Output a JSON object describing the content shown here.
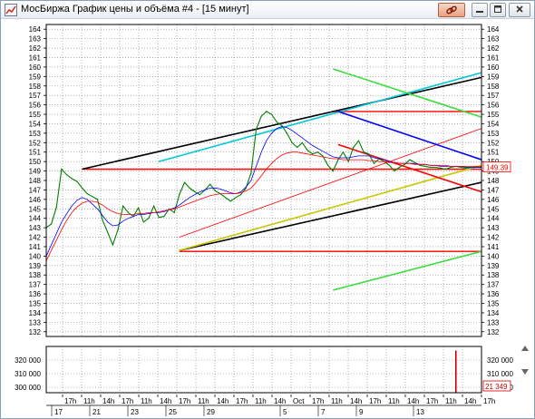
{
  "window": {
    "title": "МосБиржа График цены и объёма #4 - [15 минут]",
    "icon": "chart-app-icon",
    "controls": {
      "link": "link-icon",
      "minimize": "minimize-icon",
      "maximize": "maximize-icon",
      "close": "close-icon"
    }
  },
  "colors": {
    "price": "#008000",
    "ma_blue": "#0000ff",
    "ma_red": "#ff0000",
    "channel_black": "#000000",
    "channel_cyan": "#00c8d8",
    "channel_green": "#3cdc3c",
    "trend_yellow": "#c8c800",
    "volume_bar": "#cc0000",
    "grid": "#808080"
  },
  "chart_data": [
    {
      "type": "line",
      "name": "price",
      "y_ticks": [
        132,
        133,
        134,
        135,
        136,
        137,
        138,
        139,
        140,
        141,
        142,
        143,
        144,
        145,
        146,
        147,
        148,
        149,
        150,
        151,
        152,
        153,
        154,
        155,
        156,
        157,
        158,
        159,
        160,
        161,
        162,
        163,
        164
      ],
      "ylim": [
        131.5,
        164.5
      ],
      "current_price_label": "149.39",
      "x_time_labels": [
        "17h",
        "11h",
        "14h",
        "17h",
        "11h",
        "14h",
        "17h",
        "11h",
        "14h",
        "17h",
        "11h",
        "14h",
        "Oct",
        "17h",
        "11h",
        "14h",
        "17h",
        "11h",
        "14h",
        "17h",
        "11h",
        "14h",
        "17h"
      ],
      "x_date_labels": [
        "17",
        "21",
        "23",
        "25",
        "29",
        "5",
        "7",
        "9",
        "13"
      ],
      "x": [
        0,
        2,
        4,
        6,
        8,
        10,
        12,
        14,
        16,
        18,
        20,
        22,
        24,
        26,
        28,
        30,
        32,
        34,
        36,
        38,
        40,
        42,
        44,
        46,
        48,
        50,
        52,
        54,
        56,
        58,
        60,
        62,
        64,
        66,
        68,
        70,
        72,
        74,
        76,
        78,
        80,
        82,
        84,
        86,
        88,
        90,
        92,
        94,
        96,
        98,
        100,
        102,
        104,
        106,
        108,
        110,
        112,
        114,
        116,
        118,
        120,
        122,
        124,
        126,
        128,
        130,
        132,
        134,
        136,
        138,
        140,
        142,
        144,
        146,
        148,
        150,
        152,
        154,
        156,
        158,
        160,
        162,
        164,
        166,
        168,
        170
      ],
      "series": [
        {
          "values": [
            143.0,
            143.4,
            145.2,
            149.2,
            148.6,
            148.2,
            147.9,
            147.2,
            146.6,
            146.3,
            146.0,
            143.8,
            142.5,
            141.2,
            142.8,
            145.3,
            144.6,
            144.2,
            145.1,
            143.6,
            144.0,
            145.3,
            144.1,
            144.2,
            145.0,
            144.6,
            146.5,
            147.8,
            147.2,
            146.8,
            146.5,
            147.0,
            147.6,
            146.9,
            146.6,
            146.2,
            145.8,
            146.2,
            146.5,
            147.2,
            148.8,
            153.4,
            154.8,
            155.3,
            155.0,
            154.2,
            153.8,
            153.0,
            152.0,
            151.5,
            152.0,
            151.2,
            150.8,
            151.0,
            150.6,
            149.6,
            149.0,
            150.2,
            151.0,
            150.0,
            151.5,
            152.2,
            151.0,
            150.8,
            149.8,
            150.3,
            150.0,
            149.6,
            149.0,
            149.4,
            149.7,
            150.2,
            149.9,
            149.6,
            149.5,
            149.4,
            149.39,
            149.3,
            149.2,
            149.39,
            149.5,
            149.4,
            149.3,
            149.39,
            149.4,
            149.39
          ]
        },
        {
          "values": [
            140.0,
            141.2,
            142.4,
            143.6,
            144.5,
            145.3,
            145.9,
            146.2,
            146.0,
            145.5,
            145.0,
            144.3,
            143.6,
            143.2,
            143.3,
            143.7,
            144.0,
            144.2,
            144.4,
            144.4,
            144.5,
            144.6,
            144.6,
            144.7,
            144.9,
            145.1,
            145.4,
            145.8,
            146.2,
            146.5,
            146.8,
            147.0,
            147.2,
            147.2,
            147.1,
            146.9,
            146.7,
            146.6,
            146.8,
            147.3,
            148.0,
            149.5,
            151.0,
            152.2,
            153.0,
            153.5,
            153.7,
            153.6,
            153.3,
            152.9,
            152.5,
            152.1,
            151.7,
            151.4,
            151.1,
            150.8,
            150.5,
            150.4,
            150.4,
            150.4,
            150.5,
            150.6,
            150.6,
            150.6,
            150.4,
            150.3,
            150.2,
            150.0,
            149.9,
            149.8,
            149.8,
            149.8,
            149.8,
            149.7,
            149.7,
            149.6,
            149.6,
            149.5,
            149.5,
            149.5,
            149.5,
            149.5,
            149.4,
            149.4,
            149.4,
            149.4
          ],
          "color_key": "ma_blue"
        },
        {
          "values": [
            139.5,
            140.6,
            141.7,
            142.8,
            143.8,
            144.6,
            145.2,
            145.6,
            145.8,
            145.8,
            145.7,
            145.4,
            145.0,
            144.7,
            144.5,
            144.4,
            144.4,
            144.4,
            144.5,
            144.5,
            144.6,
            144.6,
            144.7,
            144.8,
            144.9,
            145.0,
            145.2,
            145.4,
            145.6,
            145.8,
            146.0,
            146.2,
            146.4,
            146.5,
            146.6,
            146.6,
            146.6,
            146.6,
            146.7,
            146.9,
            147.2,
            147.8,
            148.5,
            149.2,
            149.8,
            150.3,
            150.7,
            150.9,
            151.0,
            151.0,
            150.9,
            150.8,
            150.7,
            150.6,
            150.5,
            150.4,
            150.3,
            150.3,
            150.2,
            150.2,
            150.2,
            150.2,
            150.2,
            150.1,
            150.1,
            150.0,
            150.0,
            149.9,
            149.9,
            149.8,
            149.8,
            149.8,
            149.7,
            149.7,
            149.7,
            149.6,
            149.6,
            149.6,
            149.6,
            149.5,
            149.5,
            149.5,
            149.5,
            149.5,
            149.5,
            149.5
          ],
          "color_key": "ma_red"
        }
      ],
      "overlays": [
        {
          "kind": "hline",
          "y": 149.2,
          "x0": 14,
          "x1": 170,
          "color_key": "ma_red"
        },
        {
          "kind": "hline",
          "y": 140.5,
          "x0": 52,
          "x1": 170,
          "color_key": "ma_red"
        },
        {
          "kind": "hline",
          "y": 155.3,
          "x0": 112,
          "x1": 170,
          "color_key": "ma_red"
        },
        {
          "kind": "segment",
          "x0": 14,
          "y0": 149.2,
          "x1": 170,
          "y1": 158.9,
          "color_key": "channel_black"
        },
        {
          "kind": "segment",
          "x0": 52,
          "y0": 140.6,
          "x1": 170,
          "y1": 147.8,
          "color_key": "channel_black"
        },
        {
          "kind": "segment",
          "x0": 52,
          "y0": 140.6,
          "x1": 170,
          "y1": 149.6,
          "color_key": "trend_yellow"
        },
        {
          "kind": "segment",
          "x0": 52,
          "y0": 142.0,
          "x1": 170,
          "y1": 153.5,
          "color_key": "ma_red",
          "thin": true
        },
        {
          "kind": "segment",
          "x0": 44,
          "y0": 150.0,
          "x1": 170,
          "y1": 159.4,
          "color_key": "channel_cyan"
        },
        {
          "kind": "segment",
          "x0": 112,
          "y0": 159.8,
          "x1": 170,
          "y1": 154.7,
          "color_key": "channel_green"
        },
        {
          "kind": "segment",
          "x0": 112,
          "y0": 136.4,
          "x1": 170,
          "y1": 140.5,
          "color_key": "channel_green"
        },
        {
          "kind": "segment",
          "x0": 114,
          "y0": 155.3,
          "x1": 170,
          "y1": 150.2,
          "color_key": "ma_blue"
        },
        {
          "kind": "segment",
          "x0": 114,
          "y0": 151.8,
          "x1": 170,
          "y1": 146.8,
          "color_key": "ma_red"
        }
      ]
    },
    {
      "type": "bar",
      "name": "volume",
      "y_ticks": [
        300000,
        310000,
        320000
      ],
      "y_tick_labels": [
        "300 000",
        "310 000",
        "320 000"
      ],
      "ylim": [
        296000,
        330000
      ],
      "bars": [
        {
          "x": 160,
          "value": 327000
        }
      ],
      "current_value_label": "21 349"
    }
  ]
}
